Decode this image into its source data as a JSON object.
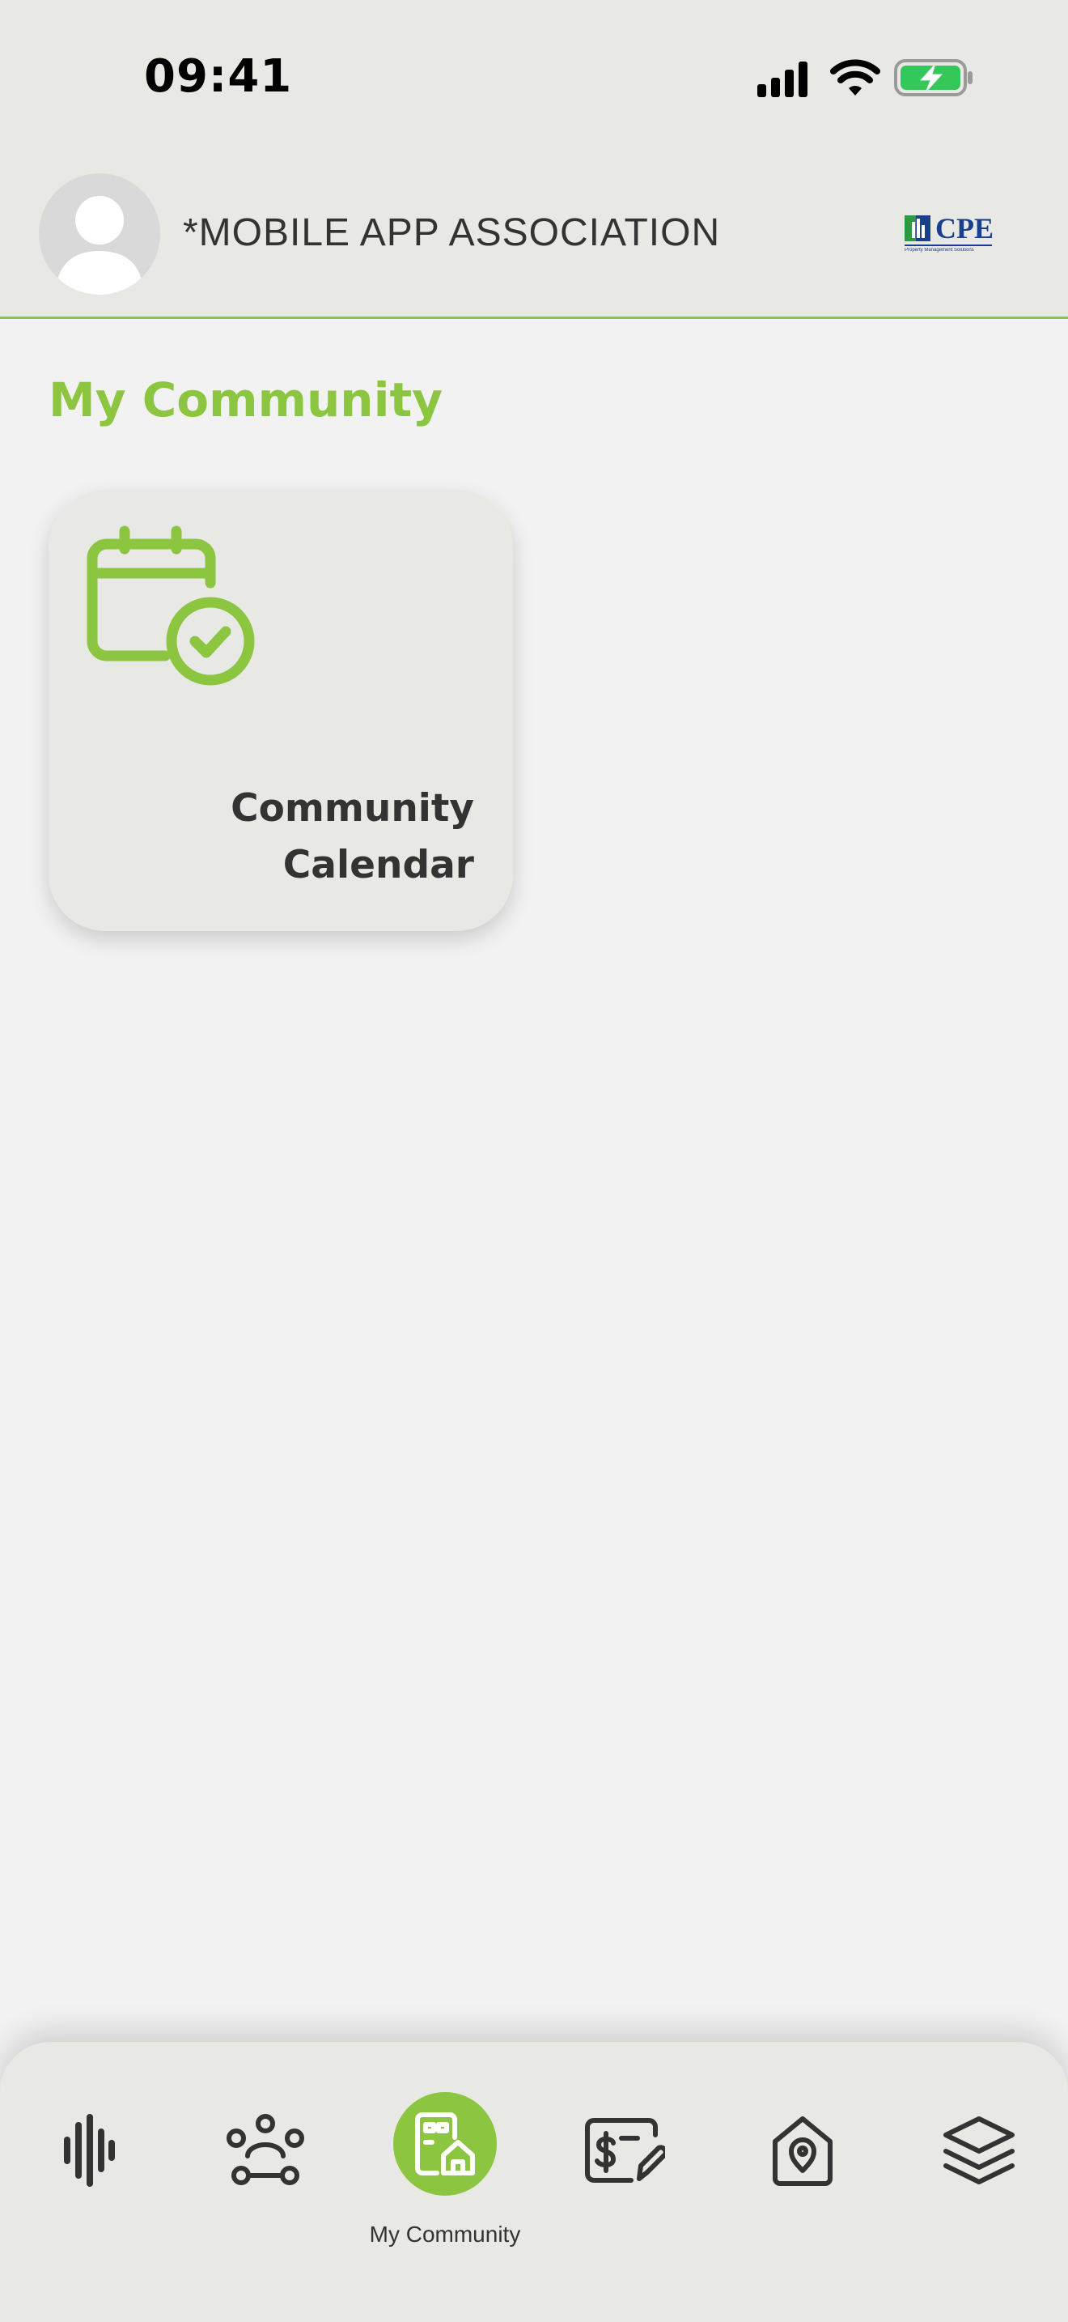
{
  "status_bar": {
    "time": "09:41"
  },
  "header": {
    "association_name": "*MOBILE APP ASSOCIATION",
    "brand": {
      "name": "CPE",
      "tagline": "Property Management Solutions"
    }
  },
  "main": {
    "title": "My Community",
    "tiles": [
      {
        "label": "Community Calendar",
        "icon": "calendar-check-icon"
      }
    ]
  },
  "bottom_nav": {
    "items": [
      {
        "icon": "waveform-icon"
      },
      {
        "icon": "people-network-icon"
      },
      {
        "icon": "community-building-icon",
        "label": "My Community",
        "active": true
      },
      {
        "icon": "dollar-edit-icon"
      },
      {
        "icon": "home-location-icon"
      },
      {
        "icon": "layers-icon"
      }
    ]
  },
  "colors": {
    "accent": "#8cc640",
    "header_bg": "#e8e8e5",
    "page_bg": "#f2f2f2",
    "text": "#333333",
    "brand_blue": "#1b3f8f"
  }
}
